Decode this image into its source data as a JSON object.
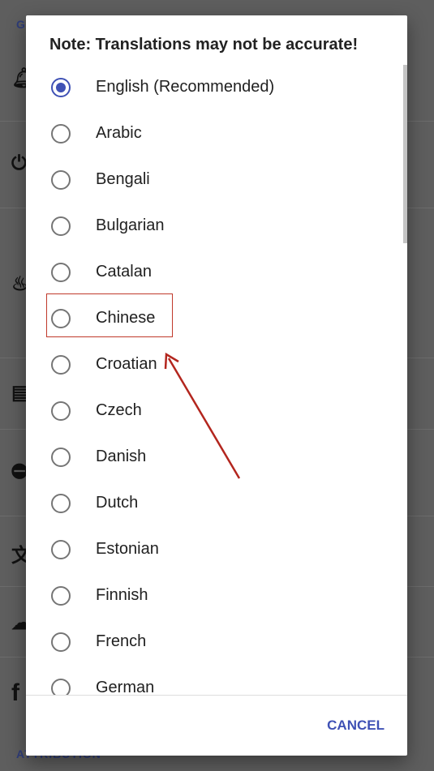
{
  "background": {
    "section_top": "G",
    "section_bottom": "ATTRIBUTION",
    "icons": [
      "bell-icon",
      "plug-icon",
      "fire-icon",
      "document-icon",
      "block-icon",
      "translate-icon",
      "cloud-upload-icon",
      "facebook-icon"
    ]
  },
  "dialog": {
    "title": "Note: Translations may not be accurate!",
    "selected": "English (Recommended)",
    "options": [
      "English (Recommended)",
      "Arabic",
      "Bengali",
      "Bulgarian",
      "Catalan",
      "Chinese",
      "Croatian",
      "Czech",
      "Danish",
      "Dutch",
      "Estonian",
      "Finnish",
      "French",
      "German"
    ],
    "cancel_label": "CANCEL"
  },
  "annotation": {
    "highlighted_option": "Chinese",
    "color": "#c0392b"
  },
  "colors": {
    "accent": "#3f51b5"
  }
}
